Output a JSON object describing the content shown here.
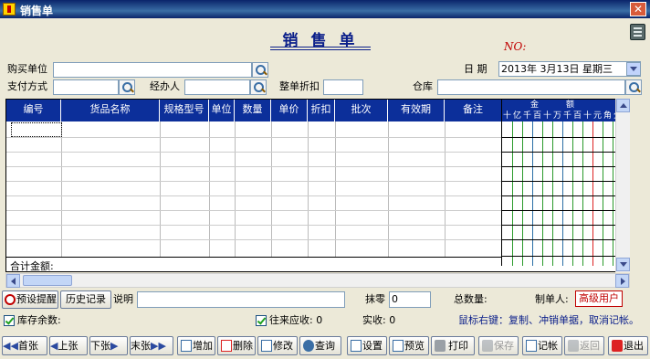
{
  "window": {
    "title": "销售单"
  },
  "header": {
    "form_title": "销售单",
    "no_label": "NO:",
    "buyer_label": "购买单位",
    "date_label": "日  期",
    "date_value": "2013年  3月13日 星期三",
    "payment_label": "支付方式",
    "handler_label": "经办人",
    "discount_label": "整单折扣",
    "warehouse_label": "仓库"
  },
  "table": {
    "columns": [
      "编号",
      "货品名称",
      "规格型号",
      "单位",
      "数量",
      "单价",
      "折扣",
      "批次",
      "有效期",
      "备注"
    ],
    "amount_title": "金额",
    "amount_digits": [
      "十",
      "亿",
      "千",
      "百",
      "十",
      "万",
      "千",
      "百",
      "十",
      "元",
      "角",
      "分"
    ],
    "total_label": "合计金额:"
  },
  "bottom": {
    "preset_reminder": "预设提醒",
    "history": "历史记录",
    "note_label": "说明",
    "rounding_label": "抹零",
    "rounding_value": "0",
    "total_qty_label": "总数量:",
    "maker_label": "制单人:",
    "maker_value": "高级用户",
    "stock_label": "库存余数:",
    "receivable_label": "往来应收: 0",
    "received_label": "实收: 0",
    "hint": "鼠标右键：复制、冲销单据，取消记帐。"
  },
  "toolbar": {
    "first": "首张",
    "prev": "上张",
    "next": "下张",
    "last": "末张",
    "add": "增加",
    "delete": "删除",
    "edit": "修改",
    "query": "查询",
    "settings": "设置",
    "preview": "预览",
    "print": "打印",
    "save": "保存",
    "post": "记帐",
    "back": "返回",
    "exit": "退出"
  }
}
